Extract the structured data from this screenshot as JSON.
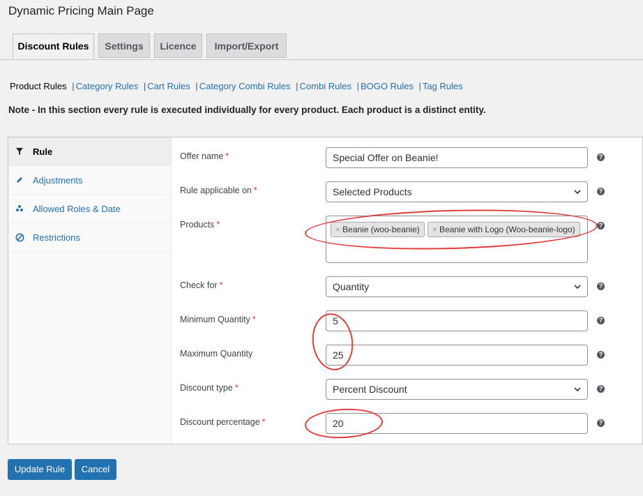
{
  "page": {
    "title": "Dynamic Pricing Main Page"
  },
  "tabs": [
    {
      "label": "Discount Rules",
      "active": true
    },
    {
      "label": "Settings"
    },
    {
      "label": "Licence"
    },
    {
      "label": "Import/Export"
    }
  ],
  "subnav": {
    "current": "Product Rules",
    "links": [
      "Category Rules",
      "Cart Rules",
      "Category Combi Rules",
      "Combi Rules",
      "BOGO Rules",
      "Tag Rules"
    ]
  },
  "note": "Note - In this section every rule is executed individually for every product. Each product is a distinct entity.",
  "sidebar": {
    "items": [
      {
        "label": "Rule",
        "icon": "filter-icon",
        "active": true
      },
      {
        "label": "Adjustments",
        "icon": "pencil-icon"
      },
      {
        "label": "Allowed Roles & Date",
        "icon": "users-icon"
      },
      {
        "label": "Restrictions",
        "icon": "prohibited-icon"
      }
    ]
  },
  "form": {
    "required_mark": "*",
    "help_glyph": "?",
    "offer_name": {
      "label": "Offer name",
      "value": "Special Offer on Beanie!"
    },
    "rule_applicable": {
      "label": "Rule applicable on",
      "value": "Selected Products"
    },
    "products": {
      "label": "Products",
      "remove_glyph": "×",
      "chips": [
        "Beanie (woo-beanie)",
        "Beanie with Logo (Woo-beanie-logo)"
      ]
    },
    "check_for": {
      "label": "Check for",
      "value": "Quantity"
    },
    "min_qty": {
      "label": "Minimum Quantity",
      "value": "5"
    },
    "max_qty": {
      "label": "Maximum Quantity",
      "value": "25"
    },
    "discount_type": {
      "label": "Discount type",
      "value": "Percent Discount"
    },
    "discount_pct": {
      "label": "Discount percentage",
      "value": "20"
    }
  },
  "buttons": {
    "update": "Update Rule",
    "cancel": "Cancel"
  },
  "colors": {
    "primary": "#2271b1",
    "annotation": "#e23c3c",
    "required": "#d63638"
  }
}
